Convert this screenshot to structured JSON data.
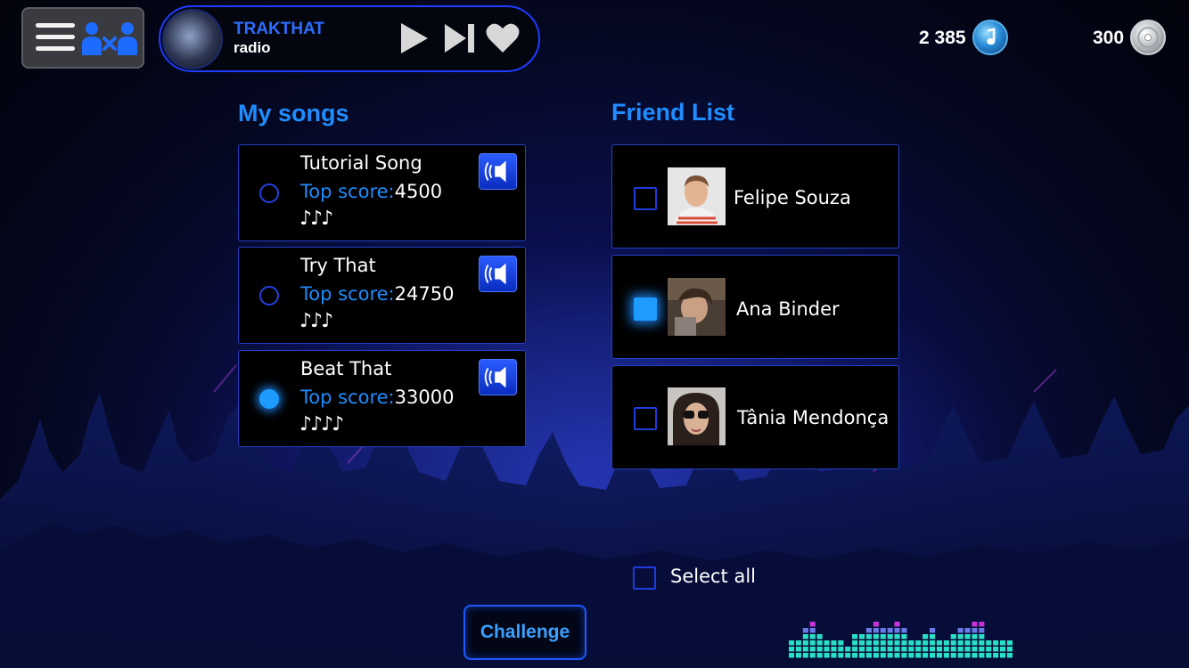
{
  "radio": {
    "title": "TRAKTHAT",
    "subtitle": "radio"
  },
  "currency": {
    "notes": "2 385",
    "discs": "300"
  },
  "songs": {
    "heading": "My songs",
    "score_label": "Top score:",
    "items": [
      {
        "title": "Tutorial Song",
        "score": "4500",
        "notes": "♪♪♪",
        "selected": false
      },
      {
        "title": "Try That",
        "score": "24750",
        "notes": "♪♪♪",
        "selected": false
      },
      {
        "title": "Beat That",
        "score": "33000",
        "notes": "♪♪♪♪",
        "selected": true
      }
    ]
  },
  "friends": {
    "heading": "Friend List",
    "items": [
      {
        "name": "Felipe Souza",
        "checked": false
      },
      {
        "name": "Ana Binder",
        "checked": true
      },
      {
        "name": "Tânia Mendonça",
        "checked": false
      }
    ],
    "select_all_label": "Select all"
  },
  "challenge_label": "Challenge",
  "colors": {
    "accent": "#1e8dff",
    "border": "#2340c8",
    "panel": "#000000",
    "eq_top": "#c832d8",
    "eq_bottom": "#28e0c8"
  },
  "icons": {
    "menu": "hamburger-icon",
    "versus": "versus-icon",
    "play": "play-icon",
    "skip": "skip-next-icon",
    "favorite": "heart-icon",
    "speaker": "speaker-icon",
    "notes_coin": "music-note-coin-icon",
    "disc_coin": "disc-coin-icon"
  }
}
